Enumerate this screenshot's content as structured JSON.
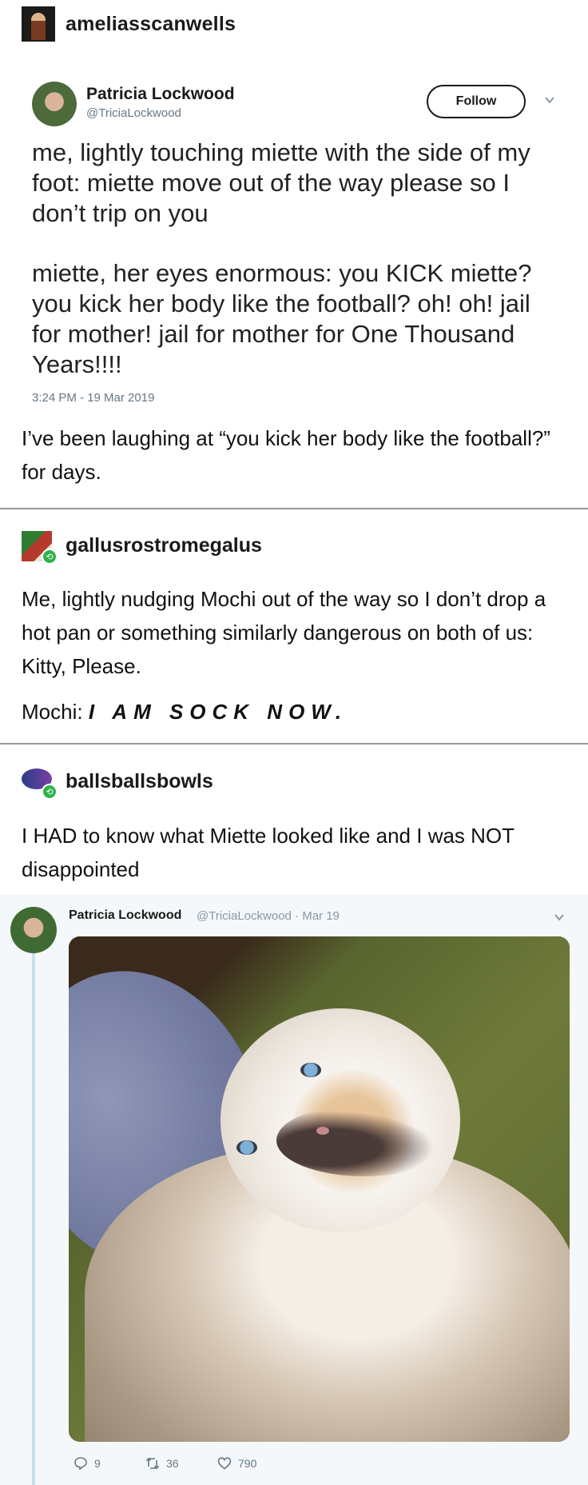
{
  "post": {
    "username": "ameliasscanwells"
  },
  "tweet1": {
    "name": "Patricia Lockwood",
    "handle": "@TriciaLockwood",
    "follow_label": "Follow",
    "text1": "me, lightly touching miette with the side of my foot: miette move out of the way please so I don’t trip on you",
    "text2": "miette, her eyes enormous: you KICK miette? you kick her body like the football? oh! oh! jail for mother! jail for mother for One Thousand Years!!!!",
    "timestamp": "3:24 PM - 19 Mar 2019"
  },
  "comment1": "I’ve been laughing at “you kick her body like the football?” for days.",
  "reblog1": {
    "username": "gallusrostromegalus",
    "text": "Me, lightly nudging Mochi out of the way so I don’t drop a hot pan or something similarly dangerous on both of us: Kitty, Please.",
    "line2_prefix": "Mochi: ",
    "line2_emph": "I AM SOCK NOW."
  },
  "reblog2": {
    "username": "ballsballsbowls",
    "text": "I HAD to know what Miette looked like and I was NOT disappointed"
  },
  "tweet2": {
    "name": "Patricia Lockwood",
    "meta": "@TriciaLockwood · Mar 19",
    "replies": "9",
    "retweets": "36",
    "likes": "790"
  },
  "icons": {
    "reblog_badge": "reblog-icon",
    "reply": "reply-icon",
    "retweet": "retweet-icon",
    "like": "heart-icon",
    "menu": "chevron-down-icon"
  }
}
